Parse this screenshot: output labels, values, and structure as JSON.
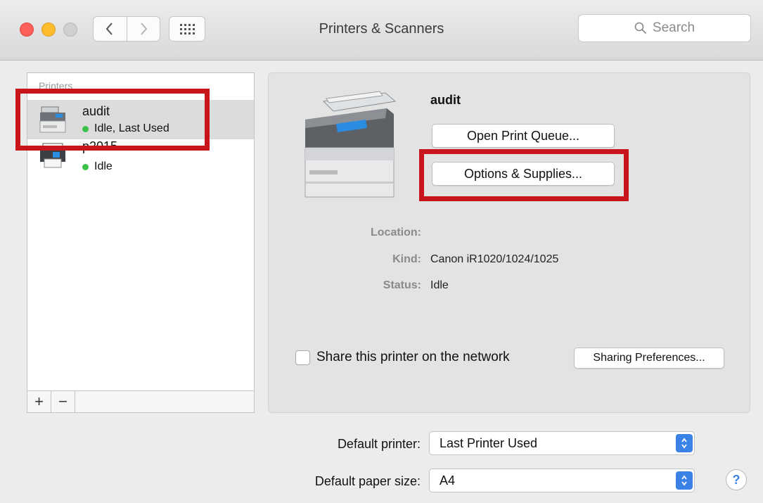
{
  "window": {
    "title": "Printers & Scanners"
  },
  "search": {
    "placeholder": "Search"
  },
  "icons": {
    "back": "chevron-left-icon",
    "forward": "chevron-right-icon",
    "grid": "grid-icon",
    "search": "magnifier-icon",
    "printer": "printer-icon"
  },
  "printers": {
    "header": "Printers",
    "items": [
      {
        "name": "audit",
        "status": "Idle, Last Used"
      },
      {
        "name": "p2015",
        "status": "Idle"
      }
    ],
    "add_label": "+",
    "remove_label": "−"
  },
  "detail": {
    "name": "audit",
    "open_queue_label": "Open Print Queue...",
    "options_label": "Options & Supplies...",
    "location_label": "Location:",
    "location_value": "",
    "kind_label": "Kind:",
    "kind_value": "Canon iR1020/1024/1025",
    "status_label": "Status:",
    "status_value": "Idle",
    "share_label": "Share this printer on the network",
    "share_checked": false,
    "sharing_prefs_label": "Sharing Preferences..."
  },
  "defaults": {
    "printer_label": "Default printer:",
    "printer_value": "Last Printer Used",
    "paper_label": "Default paper size:",
    "paper_value": "A4"
  },
  "help_label": "?",
  "colors": {
    "highlight": "#c8151b",
    "status_dot": "#3cc24b",
    "accent": "#3b82e7"
  }
}
